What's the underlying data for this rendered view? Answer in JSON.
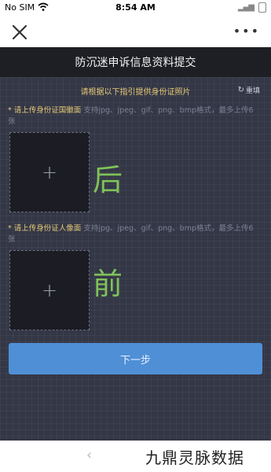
{
  "status_bar": {
    "carrier": "No SIM",
    "time": "8:54 AM"
  },
  "nav": {
    "close_icon": "close-icon",
    "more_label": "•••"
  },
  "header": {
    "title": "防沉迷申诉信息资料提交"
  },
  "instructions": {
    "text": "请根据以下指引提供身份证照片",
    "reshoot_icon": "refresh-icon",
    "reshoot_label": "重填"
  },
  "fields": [
    {
      "required_mark": "*",
      "label": "请上传身份证国徽面",
      "hint": "支持jpg、jpeg、gif、png、bmp格式，最多上传6张",
      "handwritten_note": "后"
    },
    {
      "required_mark": "*",
      "label": "请上传身份证人像面",
      "hint": "支持jpg、jpeg、gif、png、bmp格式，最多上传6张",
      "handwritten_note": "前"
    }
  ],
  "upload_icon": "plus-icon",
  "next_button": {
    "label": "下一步"
  },
  "bottom": {
    "back_icon": "chevron-left-icon",
    "watermark": "九鼎灵脉数据"
  },
  "colors": {
    "panel_bg": "#343746",
    "header_bg": "#1e1f24",
    "accent_gold": "#e6c978",
    "button_blue": "#4f8fd6",
    "handwriting_green": "#7fc25a"
  }
}
